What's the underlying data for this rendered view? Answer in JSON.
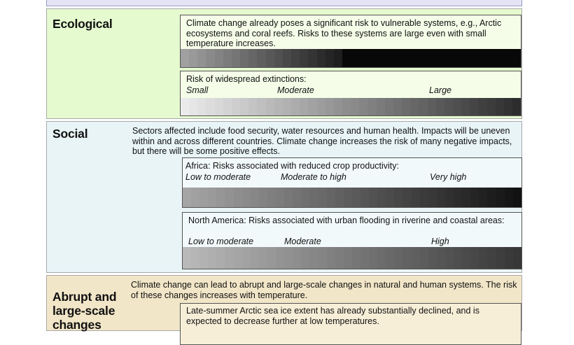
{
  "ecological": {
    "heading": "Ecological",
    "box1_text": "Climate change already poses a significant risk to vulnerable systems, e.g., Arctic ecosystems and coral reefs. Risks to these systems are large even with small temperature increases.",
    "box2_title": "Risk of widespread extinctions:",
    "box2_scale": [
      "Small",
      "Moderate",
      "Large"
    ]
  },
  "social": {
    "heading": "Social",
    "desc": "Sectors affected include food security, water resources and human health. Impacts will be uneven within and across different countries. Climate change increases the risk of many negative impacts, but there will be some positive effects.",
    "africa_region": "Africa",
    "africa_title": ": Risks associated with reduced crop productivity:",
    "africa_scale": [
      "Low to moderate",
      "Moderate to high",
      "Very high"
    ],
    "na_title": "North America: Risks associated with urban flooding in riverine and coastal areas:",
    "na_scale": [
      "Low to moderate",
      "Moderate",
      "High"
    ]
  },
  "abrupt": {
    "heading": "Abrupt and large-scale changes",
    "desc": "Climate change can lead to abrupt and large-scale changes in natural and human systems. The risk of these changes increases with temperature.",
    "box_text": "Late-summer Arctic sea ice extent has already substantially declined, and is expected to decrease further at low temperatures."
  },
  "colors": {
    "ecological_bg": "#e6fad0",
    "social_bg": "#e8f4f6",
    "abrupt_bg": "#f2e6c8",
    "top_strip_bg": "#e4e4f5"
  }
}
